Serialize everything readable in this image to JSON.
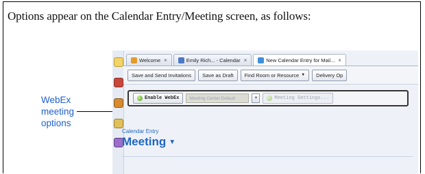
{
  "intro_text": "Options appear on the Calendar Entry/Meeting screen, as follows:",
  "callout": {
    "line1": "WebEx",
    "line2": "meeting",
    "line3": "options"
  },
  "tabs": [
    {
      "label": "Welcome",
      "icon": "home-icon"
    },
    {
      "label": "Emily Rich... - Calendar",
      "icon": "calendar-icon"
    },
    {
      "label": "New Calendar Entry for Mail...",
      "icon": "calendar-entry-icon"
    }
  ],
  "toolbar": {
    "save_send": "Save and Send Invitations",
    "save_draft": "Save as Draft",
    "find_room": "Find Room or Resource",
    "delivery": "Delivery Op"
  },
  "webex": {
    "enable": "Enable WebEx",
    "center_default": "Meeting Center Default",
    "settings": "Meeting Settings..."
  },
  "entry": {
    "subtitle": "Calendar Entry",
    "title": "Meeting"
  },
  "colors": {
    "accent": "#1f66c1",
    "callout": "#1f5fcf"
  }
}
